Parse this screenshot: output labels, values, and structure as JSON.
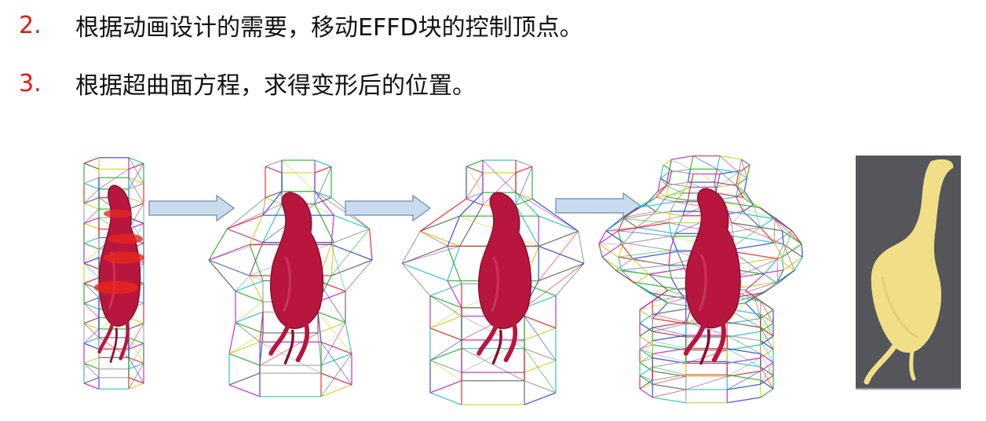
{
  "list": {
    "items": [
      {
        "number": "2.",
        "text": "根据动画设计的需要，移动EFFD块的控制顶点。"
      },
      {
        "number": "3.",
        "text": "根据超曲面方程，求得变形后的位置。"
      }
    ]
  },
  "figure": {
    "colors": {
      "organ": "#b8163f",
      "organ_dark": "#8a0f2f",
      "organ_light": "#d84a6a",
      "disc": "#e8261e",
      "arrow_fill": "#c9dcef",
      "arrow_stroke": "#7f9bb8",
      "photo_bg": "#55565b",
      "photo_object": "#f0df86",
      "wire": [
        "#e02020",
        "#20b020",
        "#2040e0",
        "#d0d020",
        "#20c0c0",
        "#c020c0",
        "#606060",
        "#a0a0a0"
      ]
    },
    "panels": [
      "lattice-initial",
      "lattice-deformed-1",
      "lattice-deformed-2",
      "lattice-deformed-dense",
      "photo-3d-print"
    ]
  }
}
